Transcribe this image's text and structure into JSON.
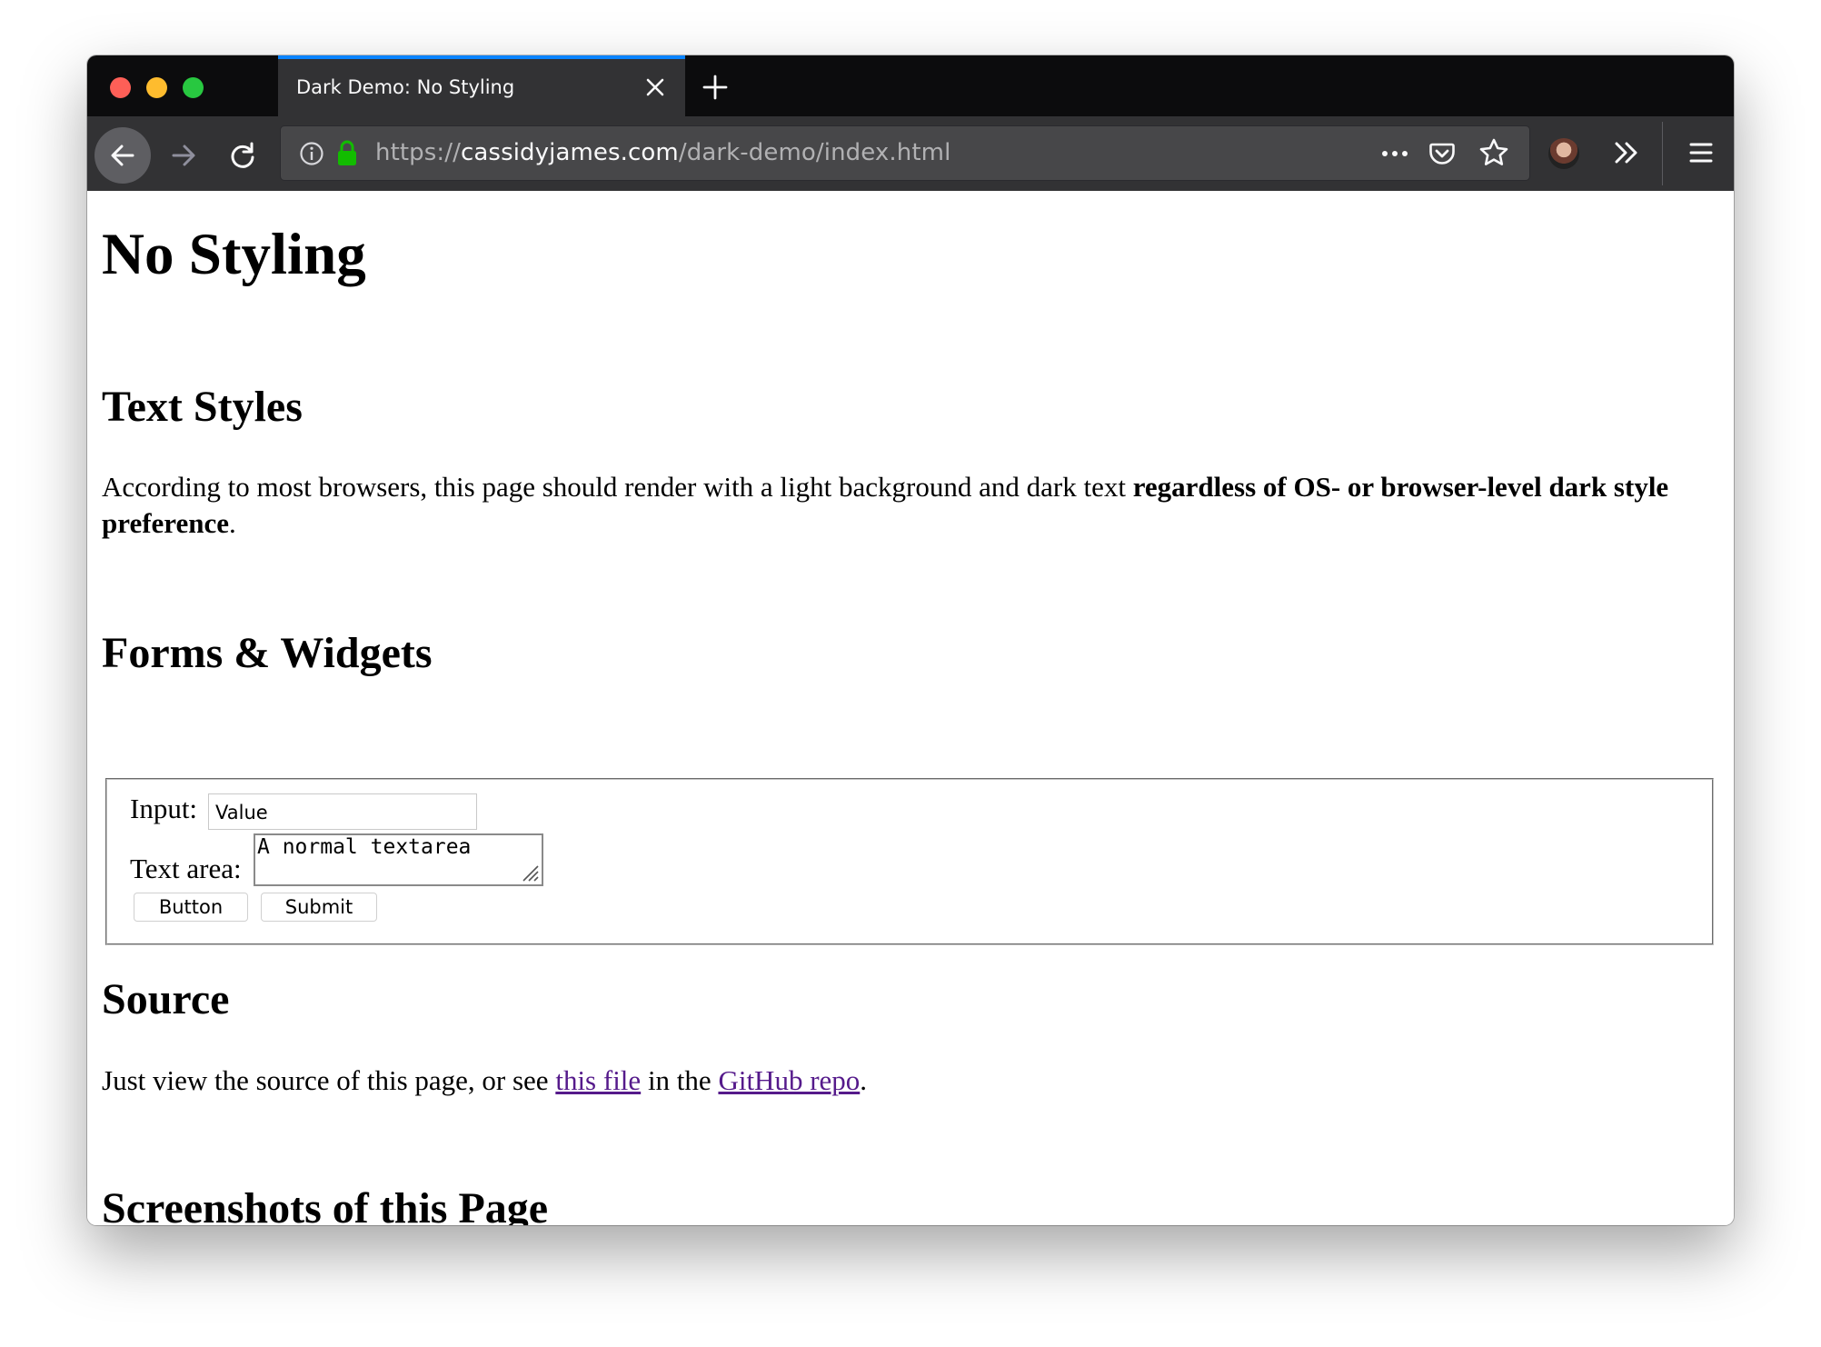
{
  "browser": {
    "tab": {
      "title": "Dark Demo: No Styling"
    },
    "url": {
      "scheme": "https://",
      "host": "cassidyjames.com",
      "path": "/dark-demo/index.html"
    }
  },
  "page": {
    "h1": "No Styling",
    "sections": {
      "text_styles": {
        "heading": "Text Styles",
        "para_before": "According to most browsers, this page should render with a light background and dark text ",
        "para_bold": "regardless of OS- or browser-level dark style preference",
        "para_after": "."
      },
      "forms": {
        "heading": "Forms & Widgets",
        "input_label": "Input:",
        "input_value": "Value",
        "textarea_label": "Text area:",
        "textarea_value": "A normal textarea",
        "button_label": "Button",
        "submit_label": "Submit"
      },
      "source": {
        "heading": "Source",
        "text_1": "Just view the source of this page, or see ",
        "link_1": "this file",
        "text_2": " in the ",
        "link_2": "GitHub repo",
        "text_3": "."
      },
      "screenshots": {
        "heading": "Screenshots of this Page"
      }
    }
  },
  "colors": {
    "tab_accent": "#0a84ff",
    "link_visited": "#551a8b",
    "lock_green": "#12bc00",
    "toolbar_bg": "#323234",
    "tabstrip_bg": "#0c0c0d"
  },
  "icons": [
    "back-arrow-icon",
    "forward-arrow-icon",
    "reload-icon",
    "info-icon",
    "lock-icon",
    "more-icon",
    "pocket-icon",
    "star-icon",
    "overflow-chevron-icon",
    "menu-icon",
    "close-icon",
    "plus-icon"
  ]
}
